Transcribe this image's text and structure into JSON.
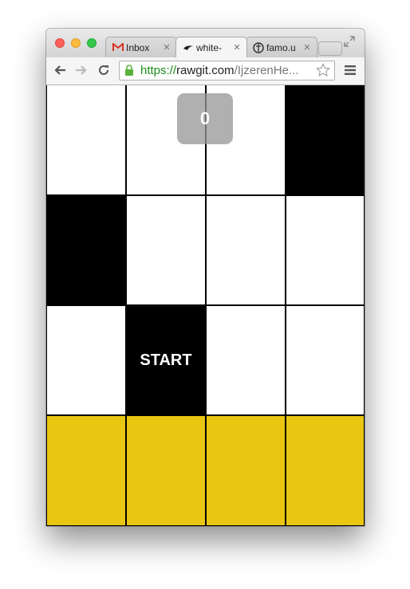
{
  "browser": {
    "tabs": [
      {
        "label": "Inbox",
        "icon": "gmail-icon",
        "active": false
      },
      {
        "label": "white-",
        "icon": "tile-game-icon",
        "active": true
      },
      {
        "label": "famo.u",
        "icon": "famous-icon",
        "active": false
      }
    ],
    "url": {
      "scheme": "https://",
      "host": "rawgit.com",
      "path": "/IjzerenHe..."
    }
  },
  "game": {
    "score": "0",
    "start_label": "START",
    "colors": {
      "white": "#ffffff",
      "black": "#000000",
      "yellow": "#e8c612"
    },
    "rows": [
      [
        "white",
        "white",
        "white",
        "black"
      ],
      [
        "black",
        "white",
        "white",
        "white"
      ],
      [
        "white",
        "black",
        "white",
        "white"
      ],
      [
        "yellow",
        "yellow",
        "yellow",
        "yellow"
      ]
    ],
    "start_tile": {
      "row": 2,
      "col": 1
    }
  }
}
